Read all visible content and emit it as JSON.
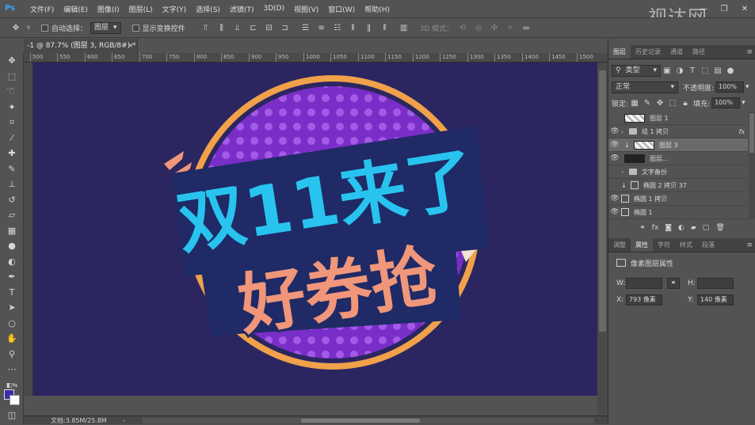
{
  "app": {
    "logo": "Ps"
  },
  "menu": [
    "文件(F)",
    "编辑(E)",
    "图像(I)",
    "图层(L)",
    "文字(Y)",
    "选择(S)",
    "滤镜(T)",
    "3D(D)",
    "视图(V)",
    "窗口(W)",
    "帮助(H)"
  ],
  "window_controls": {
    "minimize": "—",
    "restore": "❐",
    "close": "✕"
  },
  "watermark": "视达网",
  "options": {
    "auto_select_label": "自动选择：",
    "auto_select_value": "图层",
    "show_transform_label": "显示变换控件",
    "mode_3d_label": "3D 模式："
  },
  "document_tab": {
    "title": "-1 @ 87.7% (图层 3, RGB/8#) *",
    "close": "×"
  },
  "ruler_ticks": [
    "500",
    "550",
    "600",
    "650",
    "700",
    "750",
    "800",
    "850",
    "900",
    "950",
    "1000",
    "1050",
    "1100",
    "1150",
    "1200",
    "1250",
    "1300",
    "1350",
    "1400",
    "1450",
    "1500"
  ],
  "artwork": {
    "line1": "双11来了",
    "line2": "好券抢",
    "colors": {
      "bg": "#2b2660",
      "ring": "#f0a14a",
      "disc": "#7a2ec8",
      "dots": "#a35ae6",
      "cyan": "#28c4ef",
      "salmon": "#f0967a",
      "outline": "#1f2a66"
    }
  },
  "status": {
    "doc_info": "文档:3.85M/25.8M"
  },
  "layers_panel": {
    "tabs": [
      "图层",
      "历史记录",
      "通道",
      "路径"
    ],
    "filter_label": "类型",
    "blend_mode": "正常",
    "opacity_label": "不透明度:",
    "opacity_value": "100%",
    "lock_label": "锁定:",
    "fill_label": "填充:",
    "fill_value": "100%",
    "layers": [
      {
        "name": "图层 1",
        "visible": false
      },
      {
        "name": "组 1 拷贝",
        "visible": true,
        "fx": "fx"
      },
      {
        "name": "图层 3",
        "visible": true,
        "selected": true
      },
      {
        "name": "图层...",
        "visible": true
      },
      {
        "name": "文字备份",
        "visible": false
      },
      {
        "name": "椭圆 2 拷贝 37",
        "visible": false
      },
      {
        "name": "椭圆 1 拷贝",
        "visible": true
      },
      {
        "name": "椭圆 1",
        "visible": true
      }
    ]
  },
  "properties_panel": {
    "tabs": [
      "调整",
      "属性",
      "字符",
      "样式",
      "段落"
    ],
    "title": "像素图层属性",
    "w_label": "W:",
    "h_label": "H:",
    "x_label": "X:",
    "x_value": "793 像素",
    "y_label": "Y:",
    "y_value": "140 像素"
  }
}
